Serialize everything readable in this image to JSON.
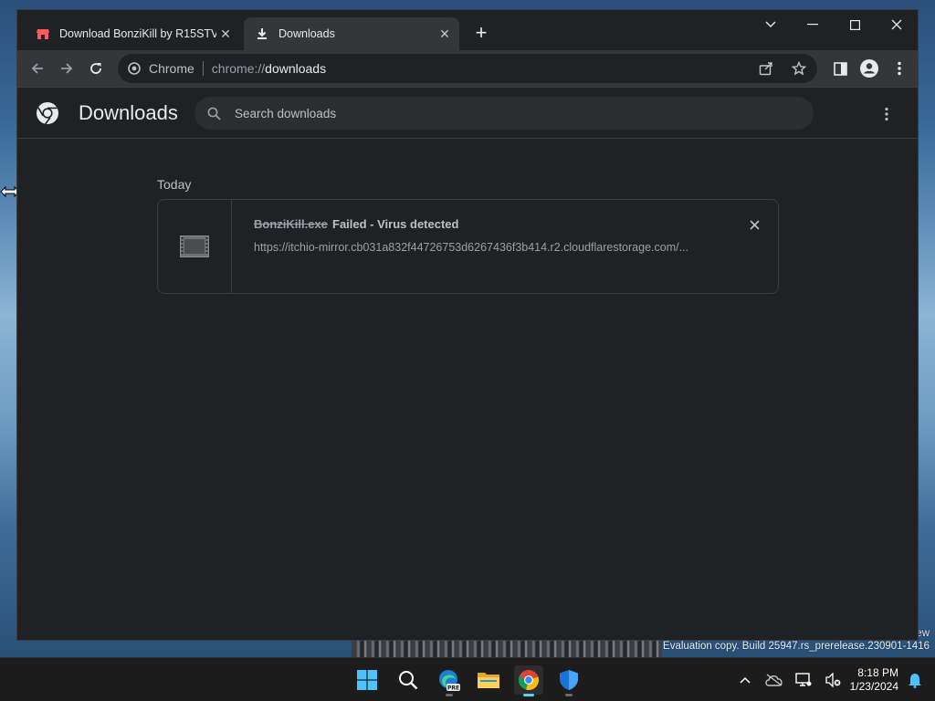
{
  "browser": {
    "tabs": [
      {
        "label": "Download BonziKill by R15STV - ",
        "icon": "itch-store-icon",
        "active": false
      },
      {
        "label": "Downloads",
        "icon": "download-icon",
        "active": true
      }
    ],
    "new_tab_label": "+",
    "omnibox": {
      "site_label": "Chrome",
      "url_scheme": "chrome://",
      "url_host": "downloads"
    }
  },
  "downloads_page": {
    "title": "Downloads",
    "search_placeholder": "Search downloads",
    "date_group": "Today",
    "items": [
      {
        "file_name": "BonziKill.exe",
        "status": "Failed - Virus detected",
        "url": "https://itchio-mirror.cb031a832f44726753d6267436f3b414.r2.cloudflarestorage.com/..."
      }
    ]
  },
  "desktop": {
    "watermark_partial": "ew",
    "watermark": "Evaluation copy. Build 25947.rs_prerelease.230901-1416"
  },
  "taskbar": {
    "apps": [
      "start-icon",
      "search-icon",
      "edge-preview-icon",
      "file-explorer-icon",
      "chrome-icon",
      "defender-icon"
    ],
    "clock_time": "8:18 PM",
    "clock_date": "1/23/2024"
  },
  "colors": {
    "window_bg": "#202124",
    "toolbar_bg": "#35363a",
    "text_primary": "#e8eaed",
    "text_secondary": "#9aa0a6",
    "taskbar_accent": "#60cdff"
  }
}
